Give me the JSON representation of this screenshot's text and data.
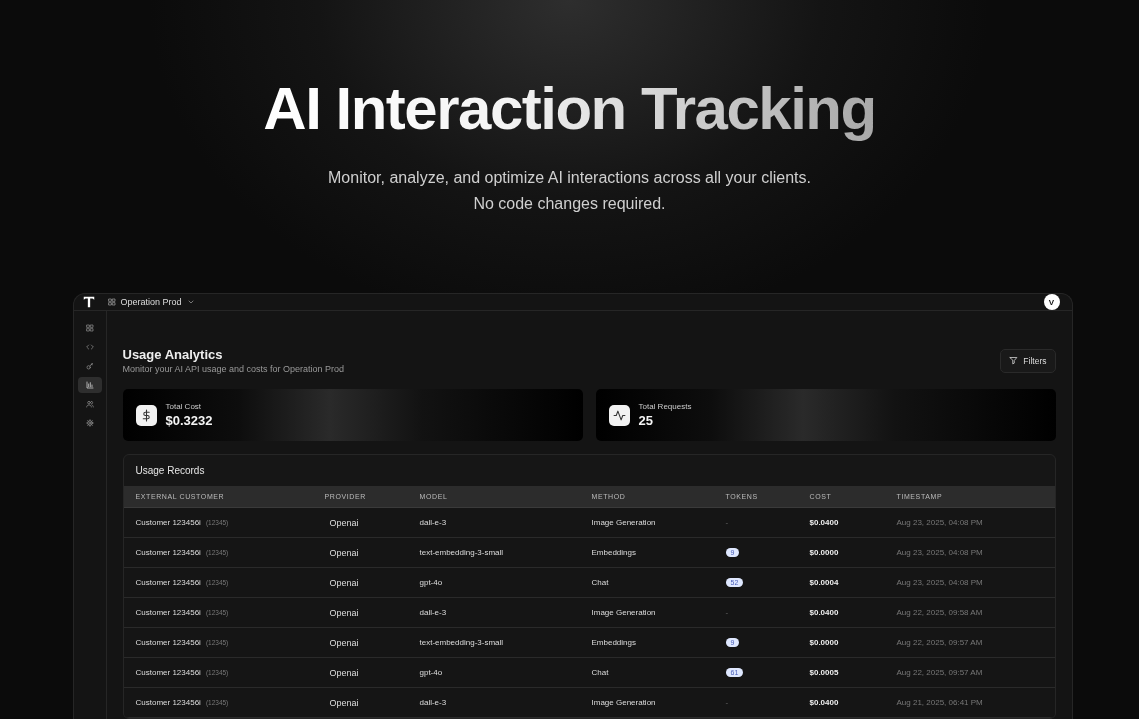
{
  "hero": {
    "title": "AI Interaction Tracking",
    "subtitle_lines": [
      "Monitor, analyze, and optimize AI interactions across all your clients.",
      "No code changes required."
    ]
  },
  "app": {
    "header": {
      "project": "Operation Prod",
      "avatar": "V"
    },
    "sidebar": {
      "items": [
        {
          "selected": false
        },
        {
          "selected": false
        },
        {
          "selected": false
        },
        {
          "selected": true
        },
        {
          "selected": false
        },
        {
          "selected": false
        }
      ]
    },
    "page": {
      "title": "Usage Analytics",
      "subtitle": "Monitor your AI API usage and costs for Operation Prod",
      "filters_button": "Filters"
    },
    "stats": [
      {
        "label": "Total Cost",
        "value": "$0.3232"
      },
      {
        "label": "Total Requests",
        "value": "25"
      }
    ],
    "table": {
      "title": "Usage Records",
      "columns": [
        "EXTERNAL CUSTOMER",
        "PROVIDER",
        "MODEL",
        "METHOD",
        "TOKENS",
        "COST",
        "TIMESTAMP"
      ],
      "rows": [
        {
          "customer": "Customer 123456i",
          "customer_id": "(12345)",
          "provider": "Openai",
          "model": "dall-e-3",
          "method": "Image Generation",
          "tokens": {
            "kind": "plain",
            "text": "-"
          },
          "cost": "$0.0400",
          "timestamp": "Aug 23, 2025, 04:08 PM"
        },
        {
          "customer": "Customer 123456i",
          "customer_id": "(12345)",
          "provider": "Openai",
          "model": "text-embedding-3-small",
          "method": "Embeddings",
          "tokens": {
            "kind": "badge",
            "text": "9"
          },
          "cost": "$0.0000",
          "timestamp": "Aug 23, 2025, 04:08 PM"
        },
        {
          "customer": "Customer 123456i",
          "customer_id": "(12345)",
          "provider": "Openai",
          "model": "gpt-4o",
          "method": "Chat",
          "tokens": {
            "kind": "badge",
            "text": "52"
          },
          "cost": "$0.0004",
          "timestamp": "Aug 23, 2025, 04:08 PM"
        },
        {
          "customer": "Customer 123456i",
          "customer_id": "(12345)",
          "provider": "Openai",
          "model": "dall-e-3",
          "method": "Image Generation",
          "tokens": {
            "kind": "plain",
            "text": "-"
          },
          "cost": "$0.0400",
          "timestamp": "Aug 22, 2025, 09:58 AM"
        },
        {
          "customer": "Customer 123456i",
          "customer_id": "(12345)",
          "provider": "Openai",
          "model": "text-embedding-3-small",
          "method": "Embeddings",
          "tokens": {
            "kind": "badge",
            "text": "9"
          },
          "cost": "$0.0000",
          "timestamp": "Aug 22, 2025, 09:57 AM"
        },
        {
          "customer": "Customer 123456i",
          "customer_id": "(12345)",
          "provider": "Openai",
          "model": "gpt-4o",
          "method": "Chat",
          "tokens": {
            "kind": "badge",
            "text": "61"
          },
          "cost": "$0.0005",
          "timestamp": "Aug 22, 2025, 09:57 AM"
        },
        {
          "customer": "Customer 123456i",
          "customer_id": "(12345)",
          "provider": "Openai",
          "model": "dall-e-3",
          "method": "Image Generation",
          "tokens": {
            "kind": "plain",
            "text": "-"
          },
          "cost": "$0.0400",
          "timestamp": "Aug 21, 2025, 06:41 PM"
        }
      ]
    }
  }
}
